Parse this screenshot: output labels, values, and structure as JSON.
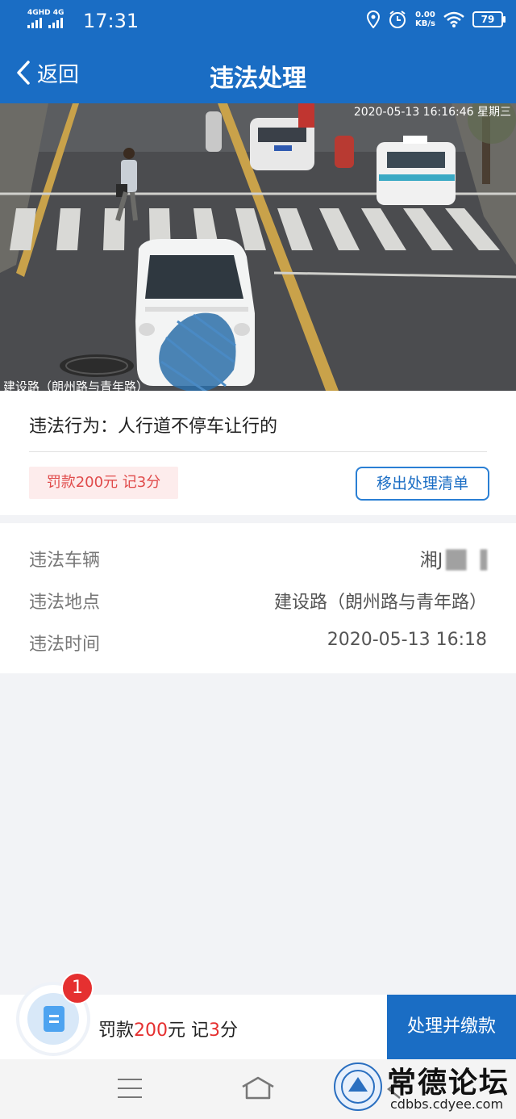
{
  "status_bar": {
    "network_top": "4GHD 4G",
    "time": "17:31",
    "speed_value": "0.00",
    "speed_unit": "KB/s",
    "battery": "79"
  },
  "header": {
    "back_label": "返回",
    "title": "违法处理"
  },
  "photo": {
    "stamp": "2020-05-13 16:16:46 星期三",
    "location_caption": "建设路（朗州路与青年路）"
  },
  "violation": {
    "behavior_label": "违法行为：",
    "behavior_value": "人行道不停车让行的",
    "penalty": "罚款200元 记3分",
    "remove_button": "移出处理清单"
  },
  "details": {
    "rows": [
      {
        "label": "违法车辆",
        "value": "湘J"
      },
      {
        "label": "违法地点",
        "value": "建设路（朗州路与青年路）"
      },
      {
        "label": "违法时间",
        "value": "2020-05-13 16:18"
      }
    ]
  },
  "action_bar": {
    "cart_count": "1",
    "summary_prefix": "罚款",
    "fine_amount": "200",
    "summary_mid": "元 记",
    "points": "3",
    "summary_suffix": "分",
    "pay_button": "处理并缴款"
  },
  "watermark": {
    "title": "常德论坛",
    "url": "cdbbs.cdyee.com"
  },
  "colors": {
    "primary": "#1a6dc4",
    "danger": "#e53030",
    "tag_bg": "#fdecec"
  }
}
